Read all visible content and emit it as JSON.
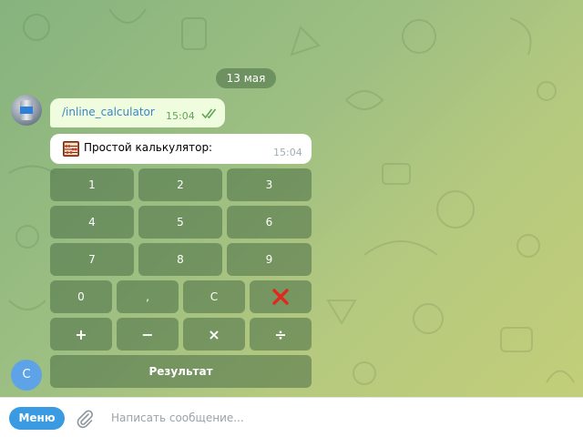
{
  "chat": {
    "date": "13 мая",
    "outgoing": {
      "text": "/inline_calculator",
      "time": "15:04",
      "status_icon": "double-check-icon"
    },
    "incoming": {
      "icon": "abacus-icon",
      "text": "Простой калькулятор:",
      "time": "15:04"
    }
  },
  "keyboard": {
    "rows": [
      [
        "1",
        "2",
        "3"
      ],
      [
        "4",
        "5",
        "6"
      ],
      [
        "7",
        "8",
        "9"
      ],
      [
        "0",
        ",",
        "C",
        "❌"
      ],
      [
        "+",
        "−",
        "×",
        "÷"
      ]
    ],
    "result": "Результат",
    "delete_color": "#e0281f"
  },
  "user_avatar": {
    "initial": "С"
  },
  "input_bar": {
    "menu_label": "Меню",
    "placeholder": "Написать сообщение..."
  },
  "colors": {
    "accent": "#3a9ae2",
    "outgoing_bubble": "#effdde",
    "keyboard_button": "rgba(74,110,70,0.55)",
    "link": "#3a86c8"
  }
}
